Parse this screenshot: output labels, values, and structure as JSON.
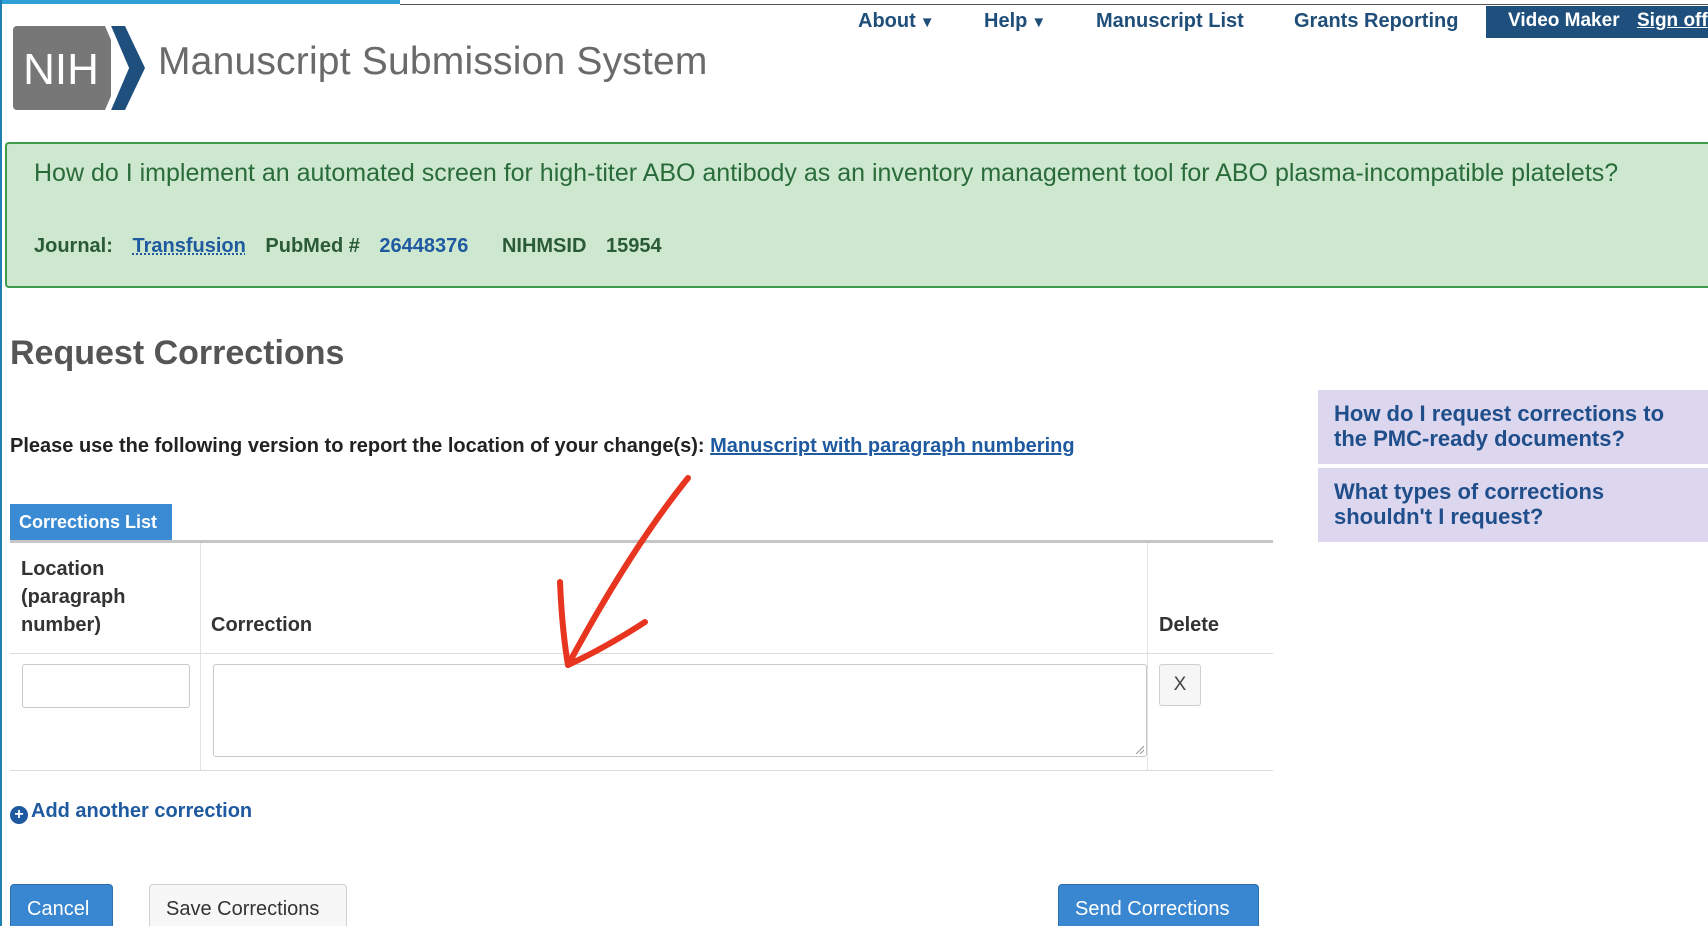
{
  "header": {
    "logo_text": "NIH",
    "site_title": "Manuscript Submission System"
  },
  "nav": {
    "about": "About",
    "help": "Help",
    "manuscript_list": "Manuscript List",
    "grants_reporting": "Grants Reporting",
    "video_maker": "Video Maker",
    "sign_off": "Sign off",
    "caret": "▼"
  },
  "banner": {
    "question": "How do I implement an automated screen for high-titer ABO antibody as an inventory management tool for ABO plasma-incompatible platelets?",
    "journal_label": "Journal:",
    "journal_name": "Transfusion",
    "pubmed_label": "PubMed #",
    "pubmed_id": "26448376",
    "nihmsid_label": "NIHMSID",
    "nihmsid_value": "15954"
  },
  "page": {
    "title": "Request Corrections",
    "instructions": "Please use the following version to report the location of your change(s):",
    "instructions_link": "Manuscript with paragraph numbering"
  },
  "help": {
    "q1": "How do I request corrections to the PMC-ready documents?",
    "q2": "What types of corrections shouldn't I request?"
  },
  "corrections": {
    "tab_label": "Corrections List",
    "col_location": "Location (paragraph number)",
    "col_correction": "Correction",
    "col_delete": "Delete",
    "delete_label": "X",
    "location_value": "",
    "correction_value": "",
    "add_label": "Add another correction",
    "add_icon": "+"
  },
  "buttons": {
    "cancel": "Cancel",
    "save": "Save Corrections",
    "send": "Send Corrections"
  },
  "colors": {
    "banner_bg": "#cde8cf",
    "banner_border": "#3f9a4c",
    "primary_button": "#3a87d1",
    "link": "#1f5aa0",
    "help_bg": "#dcd7ef",
    "annotation_arrow": "#e8351f"
  }
}
